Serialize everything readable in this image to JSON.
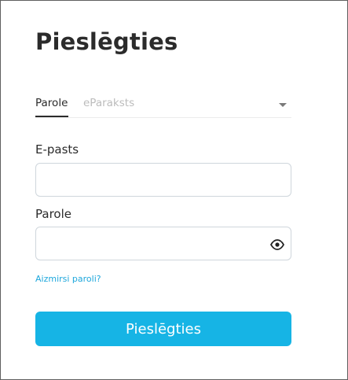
{
  "login": {
    "title": "Pieslēgties",
    "tabs": [
      {
        "label": "Parole",
        "active": true
      },
      {
        "label": "eParaksts",
        "active": false
      }
    ],
    "email": {
      "label": "E-pasts",
      "value": "",
      "placeholder": ""
    },
    "password": {
      "label": "Parole",
      "value": "",
      "placeholder": ""
    },
    "forgot_link": "Aizmirsi paroli?",
    "submit_label": "Pieslēgties",
    "icons": {
      "tab_dropdown": "caret-down-icon",
      "password_toggle": "eye-icon"
    },
    "colors": {
      "accent": "#16b4e5",
      "link": "#1ea7dc",
      "text": "#2b2b2b",
      "inactive_tab": "#bcbcbc"
    }
  }
}
